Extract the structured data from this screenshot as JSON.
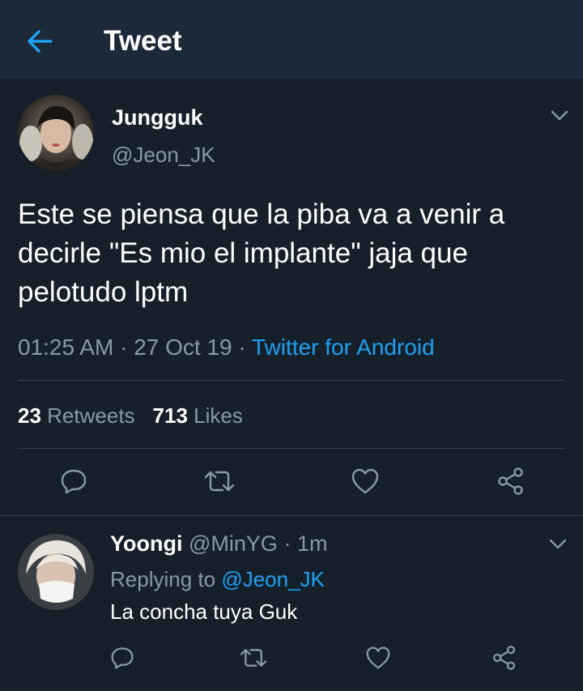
{
  "colors": {
    "background": "#15202b",
    "header_background": "#1c2938",
    "accent": "#1da1f2",
    "secondary_text": "#8899a6",
    "divider": "#38444d"
  },
  "header": {
    "back_icon": "arrow-left-icon",
    "title": "Tweet"
  },
  "tweet": {
    "author": {
      "name": "Jungguk",
      "handle": "@Jeon_JK"
    },
    "text": "Este se piensa que la piba va a venir a decirle \"Es mio el implante\" jaja que pelotudo lptm",
    "time": "01:25 AM",
    "sep1": " · ",
    "date": "27 Oct 19",
    "sep2": " · ",
    "source": "Twitter for Android",
    "retweets_count": "23",
    "retweets_label": "Retweets",
    "likes_count": "713",
    "likes_label": "Likes",
    "actions": [
      "reply-icon",
      "retweet-icon",
      "like-icon",
      "share-icon"
    ]
  },
  "reply": {
    "name": "Yoongi",
    "handle": "@MinYG",
    "sep": " · ",
    "time": "1m",
    "replying_label": "Replying to",
    "replying_to": "@Jeon_JK",
    "text": "La concha tuya Guk",
    "actions": [
      "reply-icon",
      "retweet-icon",
      "like-icon",
      "share-icon"
    ]
  }
}
